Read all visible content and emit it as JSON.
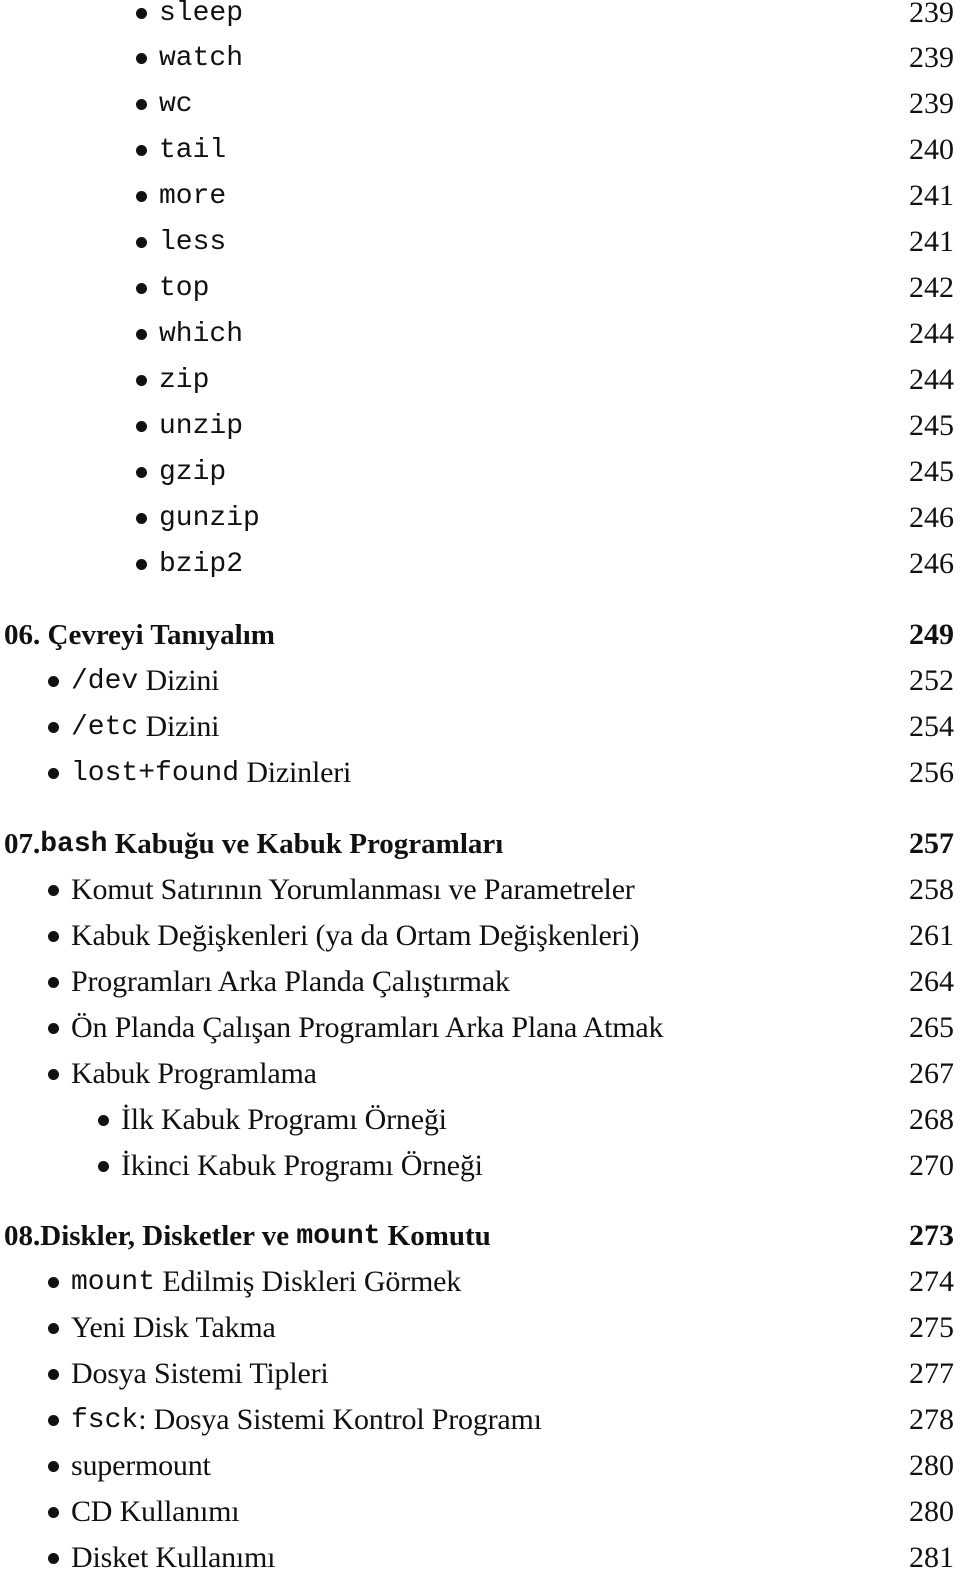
{
  "continued_items": [
    {
      "code": "sleep",
      "page": "239"
    },
    {
      "code": "watch",
      "page": "239"
    },
    {
      "code": "wc",
      "page": "239"
    },
    {
      "code": "tail",
      "page": "240"
    },
    {
      "code": "more",
      "page": "241"
    },
    {
      "code": "less",
      "page": "241"
    },
    {
      "code": "top",
      "page": "242"
    },
    {
      "code": "which",
      "page": "244"
    },
    {
      "code": "zip",
      "page": "244"
    },
    {
      "code": "unzip",
      "page": "245"
    },
    {
      "code": "gzip",
      "page": "245"
    },
    {
      "code": "gunzip",
      "page": "246"
    },
    {
      "code": "bzip2",
      "page": "246"
    }
  ],
  "chapters": [
    {
      "number": "06.",
      "title_pre": "",
      "title_code": "",
      "title_post": "Çevreyi Tanıyalım",
      "page": "249",
      "items": [
        {
          "code": "/dev",
          "text": " Dizini",
          "page": "252"
        },
        {
          "code": "/etc",
          "text": " Dizini",
          "page": "254"
        },
        {
          "code": "lost+found",
          "text": " Dizinleri",
          "page": "256"
        }
      ]
    },
    {
      "number": "07.",
      "title_pre": "",
      "title_code": "bash",
      "title_post": " Kabuğu ve Kabuk Programları",
      "page": "257",
      "items": [
        {
          "code": "",
          "text": "Komut Satırının Yorumlanması ve Parametreler",
          "page": "258"
        },
        {
          "code": "",
          "text": "Kabuk Değişkenleri (ya da Ortam Değişkenleri)",
          "page": "261"
        },
        {
          "code": "",
          "text": "Programları Arka Planda Çalıştırmak",
          "page": "264"
        },
        {
          "code": "",
          "text": "Ön Planda Çalışan Programları Arka Plana Atmak",
          "page": "265"
        },
        {
          "code": "",
          "text": "Kabuk Programlama",
          "page": "267"
        },
        {
          "code": "",
          "text": "İlk Kabuk Programı Örneği",
          "page": "268",
          "sub": true
        },
        {
          "code": "",
          "text": "İkinci Kabuk Programı Örneği",
          "page": "270",
          "sub": true
        }
      ]
    },
    {
      "number": "08.",
      "title_pre": "Diskler, Disketler ve ",
      "title_code": "mount",
      "title_post": " Komutu",
      "page": "273",
      "items": [
        {
          "code": "mount",
          "text": " Edilmiş Diskleri Görmek",
          "page": "274"
        },
        {
          "code": "",
          "text": "Yeni Disk Takma",
          "page": "275"
        },
        {
          "code": "",
          "text": "Dosya Sistemi Tipleri",
          "page": "277"
        },
        {
          "code": "fsck",
          "text": ": Dosya Sistemi Kontrol Programı",
          "page": "278"
        },
        {
          "code": "",
          "text": "supermount",
          "page": "280"
        },
        {
          "code": "",
          "text": "CD Kullanımı",
          "page": "280"
        },
        {
          "code": "",
          "text": "Disket Kullanımı",
          "page": "281"
        }
      ]
    }
  ]
}
